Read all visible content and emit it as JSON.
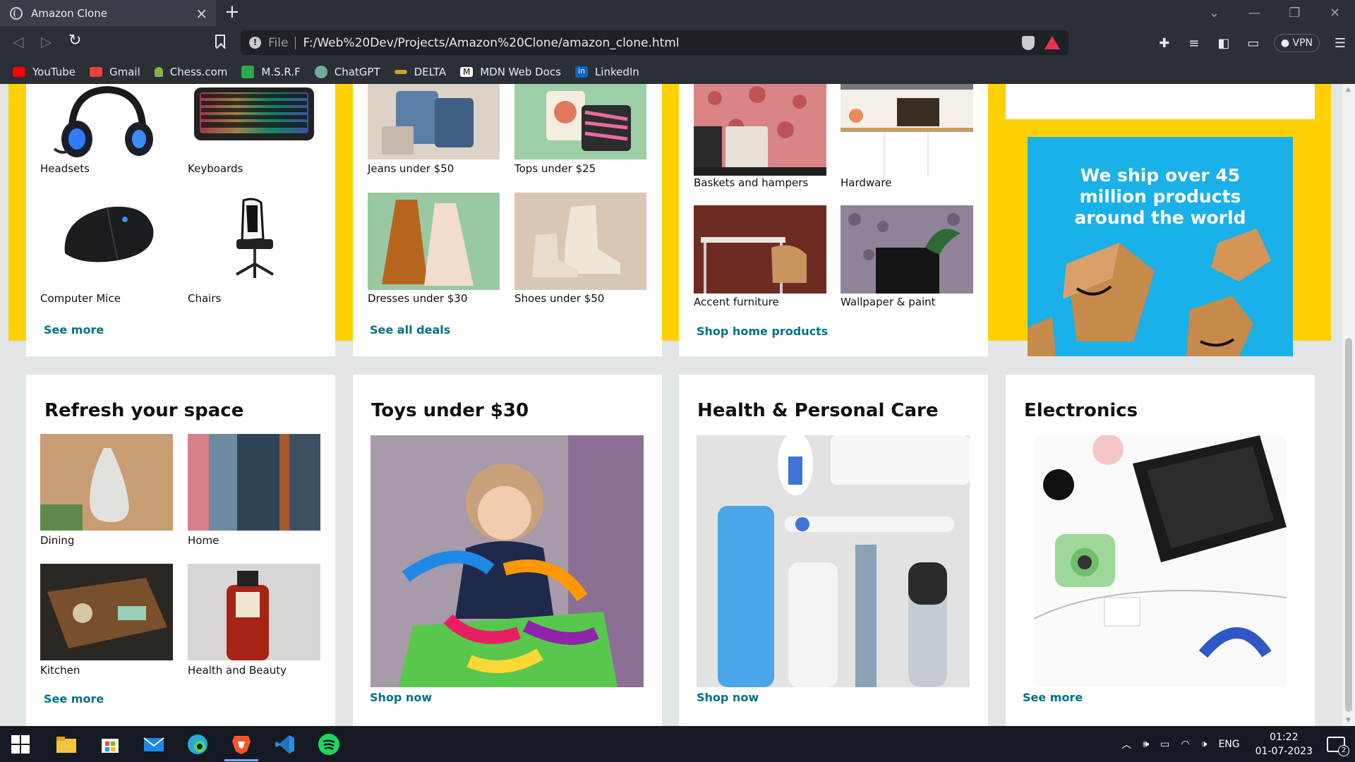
{
  "browser": {
    "tab_title": "Amazon Clone",
    "url_scheme_label": "File",
    "url": "F:/Web%20Dev/Projects/Amazon%20Clone/amazon_clone.html",
    "vpn_label": "VPN",
    "bookmarks": [
      {
        "label": "YouTube",
        "icon": "youtube-icon",
        "color": "#ff0000"
      },
      {
        "label": "Gmail",
        "icon": "gmail-icon",
        "color": "#ea4335"
      },
      {
        "label": "Chess.com",
        "icon": "chess-icon",
        "color": "#81b64c"
      },
      {
        "label": "M.S.R.F",
        "icon": "msrf-icon",
        "color": "#2aa84a"
      },
      {
        "label": "ChatGPT",
        "icon": "chatgpt-icon",
        "color": "#74aa9c"
      },
      {
        "label": "DELTA",
        "icon": "delta-icon",
        "color": "#c9a227"
      },
      {
        "label": "MDN Web Docs",
        "icon": "mdn-icon",
        "color": "#ffffff"
      },
      {
        "label": "LinkedIn",
        "icon": "linkedin-icon",
        "color": "#0a66c2"
      }
    ]
  },
  "top_row": {
    "gaming": {
      "items": [
        "Headsets",
        "Keyboards",
        "Computer Mice",
        "Chairs"
      ],
      "link": "See more"
    },
    "fashion": {
      "items": [
        "Jeans under $50",
        "Tops under $25",
        "Dresses under $30",
        "Shoes under $50"
      ],
      "link": "See all deals"
    },
    "home": {
      "items": [
        "Baskets and hampers",
        "Hardware",
        "Accent furniture",
        "Wallpaper & paint"
      ],
      "link": "Shop home products"
    },
    "shipping_banner": {
      "text": "We ship over 45 million products around the world",
      "bg_color": "#1ab0e8"
    }
  },
  "bottom_row": {
    "refresh": {
      "title": "Refresh your space",
      "items": [
        "Dining",
        "Home",
        "Kitchen",
        "Health and Beauty"
      ],
      "link": "See more"
    },
    "toys": {
      "title": "Toys under $30",
      "link": "Shop now"
    },
    "health": {
      "title": "Health & Personal Care",
      "link": "Shop now"
    },
    "electronics": {
      "title": "Electronics",
      "link": "See more"
    }
  },
  "colors": {
    "accent_link": "#007185",
    "band_yellow": "#ffd100",
    "page_bg": "#e3e6e6"
  },
  "taskbar": {
    "language": "ENG",
    "time": "01:22",
    "date": "01-07-2023",
    "notification_count": "2"
  }
}
